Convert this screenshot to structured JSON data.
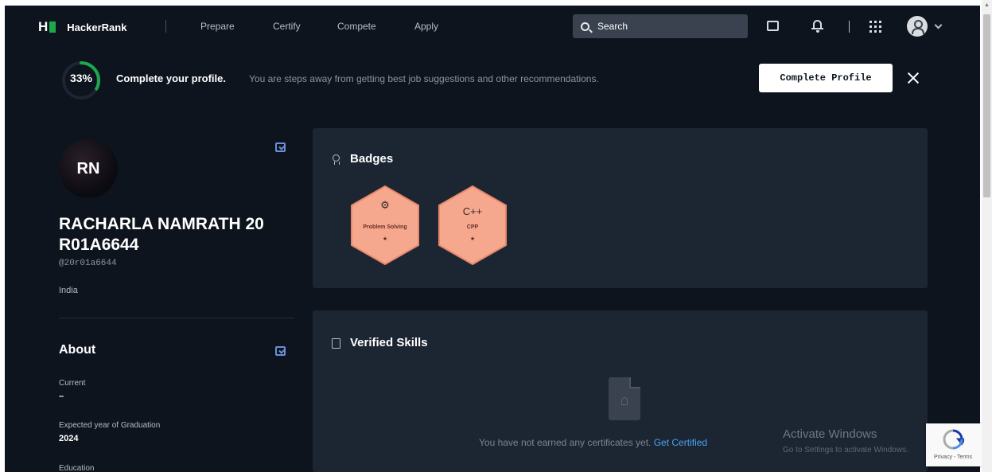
{
  "navbar": {
    "logo_mark": "H",
    "brand": "HackerRank",
    "links": [
      "Prepare",
      "Certify",
      "Compete",
      "Apply"
    ],
    "search_placeholder": "Search"
  },
  "banner": {
    "progress_text": "33%",
    "progress_value": 0.33,
    "title": "Complete your profile.",
    "subtitle": "You are steps away from getting best job suggestions and other recommendations.",
    "button_label": "Complete Profile"
  },
  "profile": {
    "initials": "RN",
    "name": "RACHARLA NAMRATH 20 R01A6644",
    "username": "@20r01a6644",
    "country": "India"
  },
  "about": {
    "title": "About",
    "fields": [
      {
        "label": "Current",
        "value": "–"
      },
      {
        "label": "Expected year of Graduation",
        "value": "2024"
      },
      {
        "label": "Education",
        "value": ""
      }
    ]
  },
  "badges": {
    "title": "Badges",
    "items": [
      {
        "label": "Problem Solving",
        "glyph": "⚙",
        "stars": "★",
        "icon": "problem-solving-icon"
      },
      {
        "label": "CPP",
        "glyph": "C++",
        "stars": "★",
        "icon": "cpp-icon"
      }
    ]
  },
  "verified_skills": {
    "title": "Verified Skills",
    "empty_text": "You have not earned any certificates yet.",
    "link": "Get Certified"
  },
  "watermark": {
    "title": "Activate Windows",
    "subtitle": "Go to Settings to activate Windows."
  },
  "recaptcha": {
    "terms": "Privacy - Terms"
  },
  "colors": {
    "background": "#0e141e",
    "card": "#1c2532",
    "accent_green": "#1ba94c",
    "link_blue": "#4ba3f5",
    "badge_fill": "#f5a88e"
  }
}
